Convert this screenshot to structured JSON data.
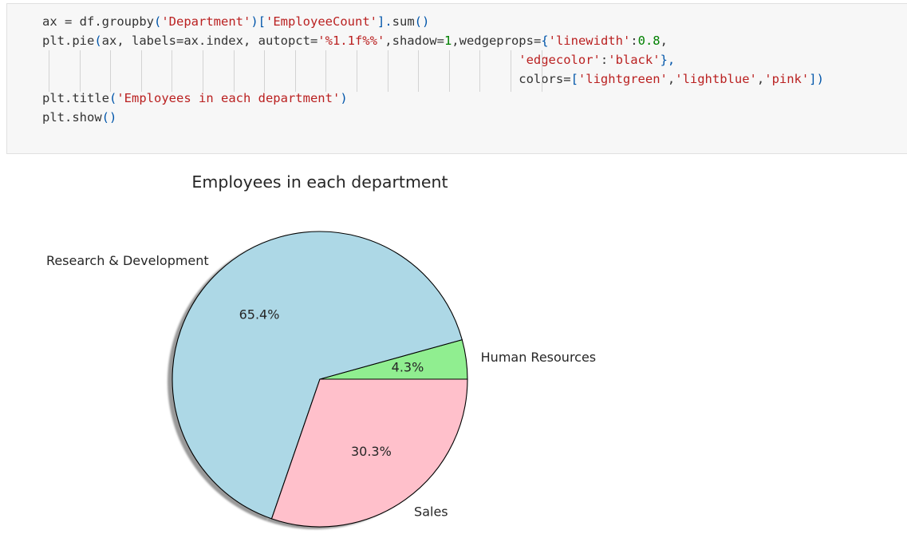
{
  "code_cell": {
    "lines": [
      [
        {
          "t": "ax ",
          "c": "var"
        },
        {
          "t": "= ",
          "c": "op"
        },
        {
          "t": "df.groupby",
          "c": "fn"
        },
        {
          "t": "(",
          "c": "punc"
        },
        {
          "t": "'Department'",
          "c": "str"
        },
        {
          "t": ")[",
          "c": "punc"
        },
        {
          "t": "'EmployeeCount'",
          "c": "str"
        },
        {
          "t": "].",
          "c": "punc"
        },
        {
          "t": "sum",
          "c": "fn"
        },
        {
          "t": "()",
          "c": "punc"
        }
      ],
      [
        {
          "t": "plt.pie",
          "c": "fn"
        },
        {
          "t": "(",
          "c": "punc"
        },
        {
          "t": "ax, labels=ax.index, autopct=",
          "c": "var"
        },
        {
          "t": "'%1.1f%%'",
          "c": "str"
        },
        {
          "t": ",shadow=",
          "c": "var"
        },
        {
          "t": "1",
          "c": "num"
        },
        {
          "t": ",wedgeprops=",
          "c": "var"
        },
        {
          "t": "{",
          "c": "punc"
        },
        {
          "t": "'linewidth'",
          "c": "str"
        },
        {
          "t": ":",
          "c": "var"
        },
        {
          "t": "0.8",
          "c": "num"
        },
        {
          "t": ",",
          "c": "var"
        }
      ],
      [
        {
          "t": "                                                                'edgecolor'",
          "c": "str"
        },
        {
          "t": ":",
          "c": "var"
        },
        {
          "t": "'black'",
          "c": "str"
        },
        {
          "t": "},",
          "c": "punc"
        }
      ],
      [
        {
          "t": "                                                                colors=",
          "c": "var"
        },
        {
          "t": "[",
          "c": "punc"
        },
        {
          "t": "'lightgreen'",
          "c": "str"
        },
        {
          "t": ",",
          "c": "var"
        },
        {
          "t": "'lightblue'",
          "c": "str"
        },
        {
          "t": ",",
          "c": "var"
        },
        {
          "t": "'pink'",
          "c": "str"
        },
        {
          "t": "])",
          "c": "punc"
        }
      ],
      [
        {
          "t": "plt.title",
          "c": "fn"
        },
        {
          "t": "(",
          "c": "punc"
        },
        {
          "t": "'Employees in each department'",
          "c": "str"
        },
        {
          "t": ")",
          "c": "punc"
        }
      ],
      [
        {
          "t": "plt.show",
          "c": "fn"
        },
        {
          "t": "()",
          "c": "punc"
        }
      ]
    ]
  },
  "chart_data": {
    "type": "pie",
    "title": "Employees in each department",
    "categories": [
      "Human Resources",
      "Research & Development",
      "Sales"
    ],
    "values": [
      4.3,
      65.4,
      30.3
    ],
    "percent_labels": [
      "4.3%",
      "65.4%",
      "30.3%"
    ],
    "colors": [
      "#90ee90",
      "#add8e6",
      "#ffc0cb"
    ],
    "edgecolor": "#000000",
    "shadow": true,
    "start_angle_deg": 0,
    "direction": "counterclockwise"
  }
}
